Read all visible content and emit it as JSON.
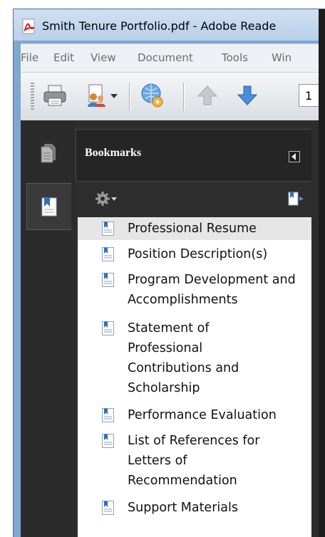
{
  "window": {
    "title": "Smith Tenure Portfolio.pdf - Adobe Reade"
  },
  "menu": {
    "items": [
      "File",
      "Edit",
      "View",
      "Document",
      "Tools",
      "Win"
    ]
  },
  "toolbar": {
    "page_number": "1",
    "icons": [
      "print-icon",
      "collaborate-icon",
      "dropdown-arrow-icon",
      "settings-globe-icon",
      "previous-page-icon",
      "next-page-icon"
    ]
  },
  "nav_panel": {
    "buttons": [
      "pages-icon",
      "bookmarks-icon"
    ]
  },
  "bookmarks_panel": {
    "title": "Bookmarks",
    "options_icon": "gear-icon",
    "expand_icon": "expand-bookmark-icon",
    "items": [
      {
        "label": "Professional Resume",
        "selected": true
      },
      {
        "label": "Position Description(s)",
        "selected": false
      },
      {
        "label": "Program Development and Accomplishments",
        "selected": false
      },
      {
        "label": "Statement of Professional Contributions and Scholarship",
        "selected": false
      },
      {
        "label": "Performance Evaluation",
        "selected": false
      },
      {
        "label": "List of References for Letters of Recommendation",
        "selected": false
      },
      {
        "label": "Support Materials",
        "selected": false
      }
    ]
  },
  "colors": {
    "panel_bg": "#2d2d2d",
    "titlebar": "#b9d0ea",
    "selected_row": "#e6e6e6"
  }
}
